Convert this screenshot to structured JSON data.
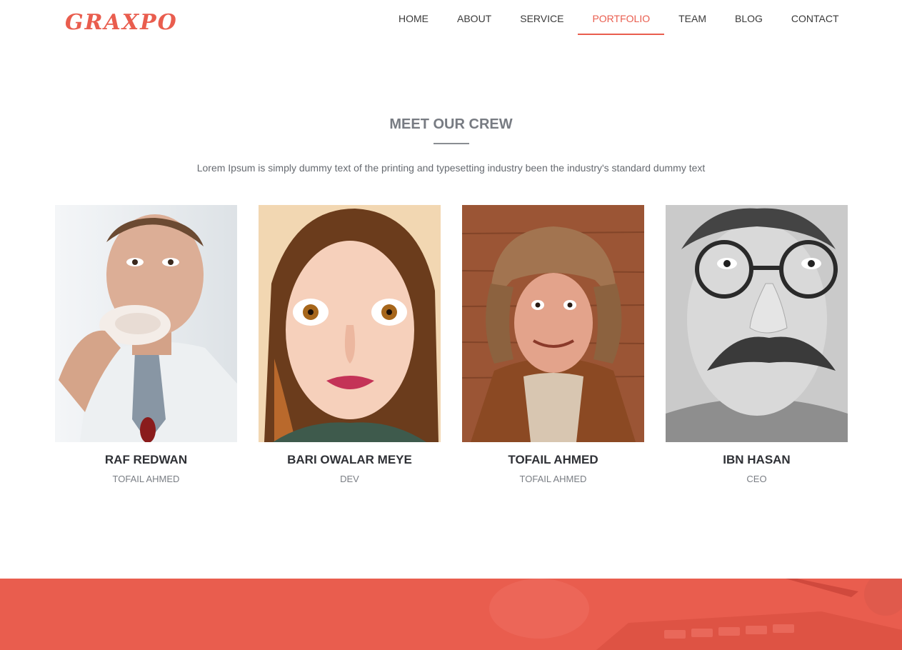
{
  "brand": {
    "logo_text": "GRAXPO",
    "accent_color": "#e95d4e"
  },
  "nav": {
    "items": [
      {
        "label": "HOME",
        "active": false
      },
      {
        "label": "ABOUT",
        "active": false
      },
      {
        "label": "SERVICE",
        "active": false
      },
      {
        "label": "PORTFOLIO",
        "active": true
      },
      {
        "label": "TEAM",
        "active": false
      },
      {
        "label": "BLOG",
        "active": false
      },
      {
        "label": "CONTACT",
        "active": false
      }
    ]
  },
  "section": {
    "title": "MEET OUR CREW",
    "subtitle": "Lorem Ipsum is simply dummy text of the printing and typesetting industry been the industry's standard dummy text"
  },
  "team": [
    {
      "name": "RAF REDWAN",
      "role": "TOFAIL AHMED",
      "photo_icon": "man-eating-donut-photo"
    },
    {
      "name": "BARI OWALAR MEYE",
      "role": "DEV",
      "photo_icon": "woman-wide-eyes-photo"
    },
    {
      "name": "TOFAIL AHMED",
      "role": "TOFAIL AHMED",
      "photo_icon": "man-fur-hat-photo"
    },
    {
      "name": "IBN HASAN",
      "role": "CEO",
      "photo_icon": "man-disguise-glasses-photo"
    }
  ]
}
